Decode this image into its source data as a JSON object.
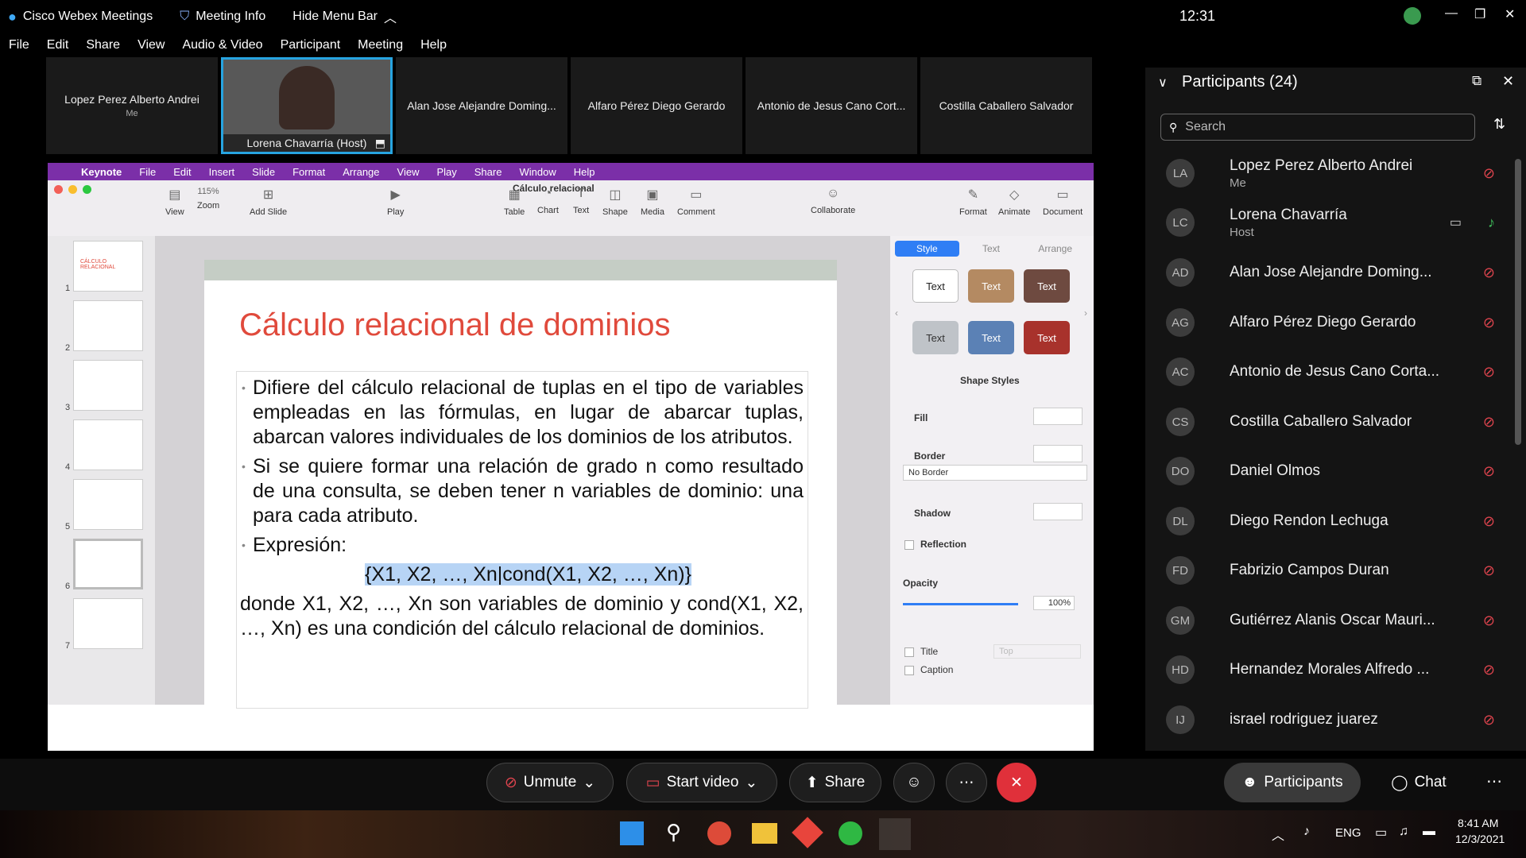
{
  "window": {
    "app_name": "Cisco Webex Meetings",
    "meeting_info": "Meeting Info",
    "hide_menu": "Hide Menu Bar",
    "clock": "12:31"
  },
  "menu": [
    "File",
    "Edit",
    "Share",
    "View",
    "Audio & Video",
    "Participant",
    "Meeting",
    "Help"
  ],
  "tiles": [
    {
      "name": "Lopez Perez Alberto Andrei",
      "sub": "Me"
    },
    {
      "name": "Lorena Chavarría  (Host)"
    },
    {
      "name": "Alan Jose Alejandre Doming..."
    },
    {
      "name": "Alfaro Pérez Diego Gerardo"
    },
    {
      "name": "Antonio de Jesus Cano Cort..."
    },
    {
      "name": "Costilla Caballero Salvador"
    }
  ],
  "keynote": {
    "menu": [
      "Keynote",
      "File",
      "Edit",
      "Insert",
      "Slide",
      "Format",
      "Arrange",
      "View",
      "Play",
      "Share",
      "Window",
      "Help"
    ],
    "doc_title": "Cálculo relacional",
    "zoom": "115%",
    "toolbar": [
      "View",
      "Zoom",
      "Add Slide",
      "Play",
      "Table",
      "Chart",
      "Text",
      "Shape",
      "Media",
      "Comment",
      "Collaborate",
      "Format",
      "Animate",
      "Document"
    ],
    "slide_numbers": [
      "1",
      "2",
      "3",
      "4",
      "5",
      "6",
      "7"
    ],
    "thumb1_title": "CÁLCULO RELACIONAL",
    "slide": {
      "title": "Cálculo relacional de dominios",
      "b1": "Difiere del cálculo relacional de tuplas en el tipo de variables empleadas en las fórmulas, en lugar de abarcar tuplas, abarcan valores individuales de los dominios de los atributos.",
      "b2": "Si se quiere formar una relación de grado n como resultado de una consulta, se deben tener n variables de dominio: una para cada atributo.",
      "b3": "Expresión:",
      "expr": "{X1, X2, …, Xn|cond(X1, X2, …, Xn)}",
      "tail": "donde X1, X2, …, Xn son variables de dominio y cond(X1, X2, …, Xn) es una condición del cálculo relacional de dominios."
    },
    "inspector": {
      "tabs": [
        "Style",
        "Text",
        "Arrange"
      ],
      "swatch_label": "Text",
      "shape_styles": "Shape Styles",
      "fill": "Fill",
      "border": "Border",
      "border_value": "No Border",
      "shadow": "Shadow",
      "reflection": "Reflection",
      "opacity": "Opacity",
      "opacity_value": "100%",
      "title": "Title",
      "title_pos": "Top",
      "caption": "Caption"
    }
  },
  "participants": {
    "header": "Participants (24)",
    "search_placeholder": "Search",
    "list": [
      {
        "initials": "LA",
        "name": "Lopez Perez Alberto Andrei",
        "sub": "Me"
      },
      {
        "initials": "LC",
        "name": "Lorena Chavarría",
        "sub": "Host"
      },
      {
        "initials": "AD",
        "name": "Alan Jose Alejandre Doming..."
      },
      {
        "initials": "AG",
        "name": "Alfaro Pérez Diego Gerardo"
      },
      {
        "initials": "AC",
        "name": "Antonio de Jesus Cano Corta..."
      },
      {
        "initials": "CS",
        "name": "Costilla Caballero Salvador"
      },
      {
        "initials": "DO",
        "name": "Daniel Olmos"
      },
      {
        "initials": "DL",
        "name": "Diego Rendon Lechuga"
      },
      {
        "initials": "FD",
        "name": "Fabrizio Campos Duran"
      },
      {
        "initials": "GM",
        "name": "Gutiérrez Alanis Oscar Mauri..."
      },
      {
        "initials": "HD",
        "name": "Hernandez Morales Alfredo ..."
      },
      {
        "initials": "IJ",
        "name": "israel rodriguez juarez"
      }
    ]
  },
  "controls": {
    "unmute": "Unmute",
    "start_video": "Start video",
    "share": "Share",
    "participants": "Participants",
    "chat": "Chat"
  },
  "taskbar": {
    "lang": "ENG",
    "time": "8:41 AM",
    "date": "12/3/2021"
  }
}
